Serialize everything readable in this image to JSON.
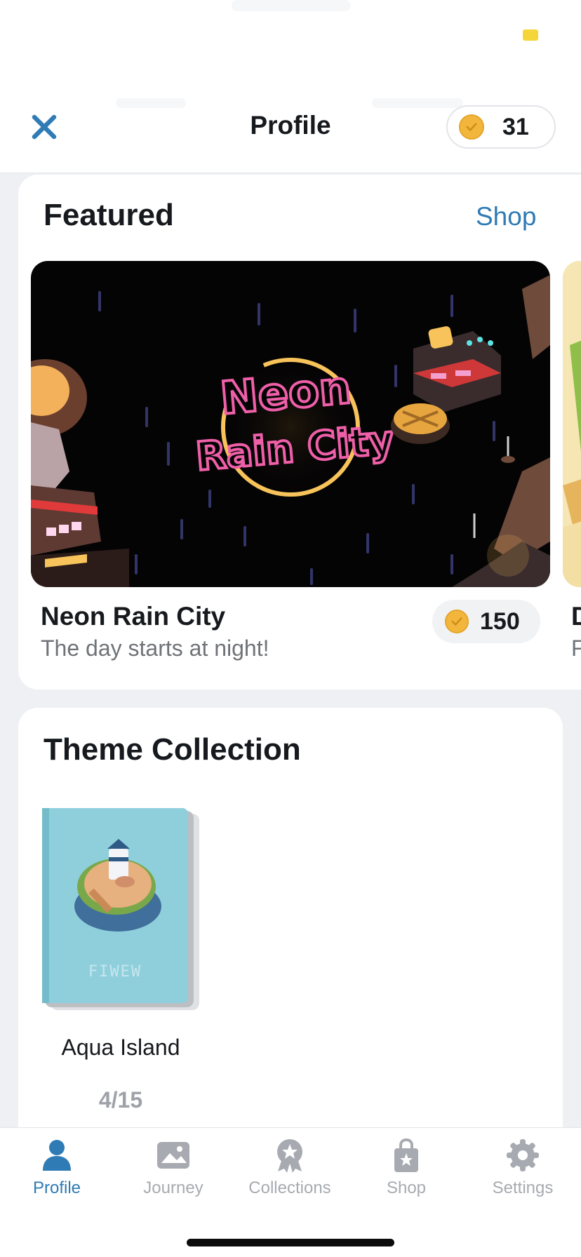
{
  "header": {
    "title": "Profile",
    "coin_balance": "31"
  },
  "featured": {
    "title": "Featured",
    "shop_link": "Shop",
    "item": {
      "banner_text_line1": "Neon",
      "banner_text_line2": "Rain City",
      "name": "Neon Rain City",
      "description": "The day starts at night!",
      "price": "150"
    },
    "next_item_peek": {
      "name_initial": "D",
      "description_initial": "F"
    }
  },
  "theme_collection": {
    "title": "Theme Collection",
    "items": [
      {
        "name": "Aqua Island",
        "progress": "4/15",
        "cover_text": "FIWEW"
      }
    ]
  },
  "tabbar": {
    "tabs": [
      {
        "label": "Profile",
        "icon": "person-icon",
        "active": true
      },
      {
        "label": "Journey",
        "icon": "photo-icon",
        "active": false
      },
      {
        "label": "Collections",
        "icon": "award-icon",
        "active": false
      },
      {
        "label": "Shop",
        "icon": "shopping-bag-icon",
        "active": false
      },
      {
        "label": "Settings",
        "icon": "gear-icon",
        "active": false
      }
    ]
  },
  "colors": {
    "accent": "#2f7bb5",
    "coin": "#f3b63d",
    "neon_pink": "#ee5fa8",
    "neon_gold": "#f7c35a",
    "inactive": "#a7abb1"
  }
}
